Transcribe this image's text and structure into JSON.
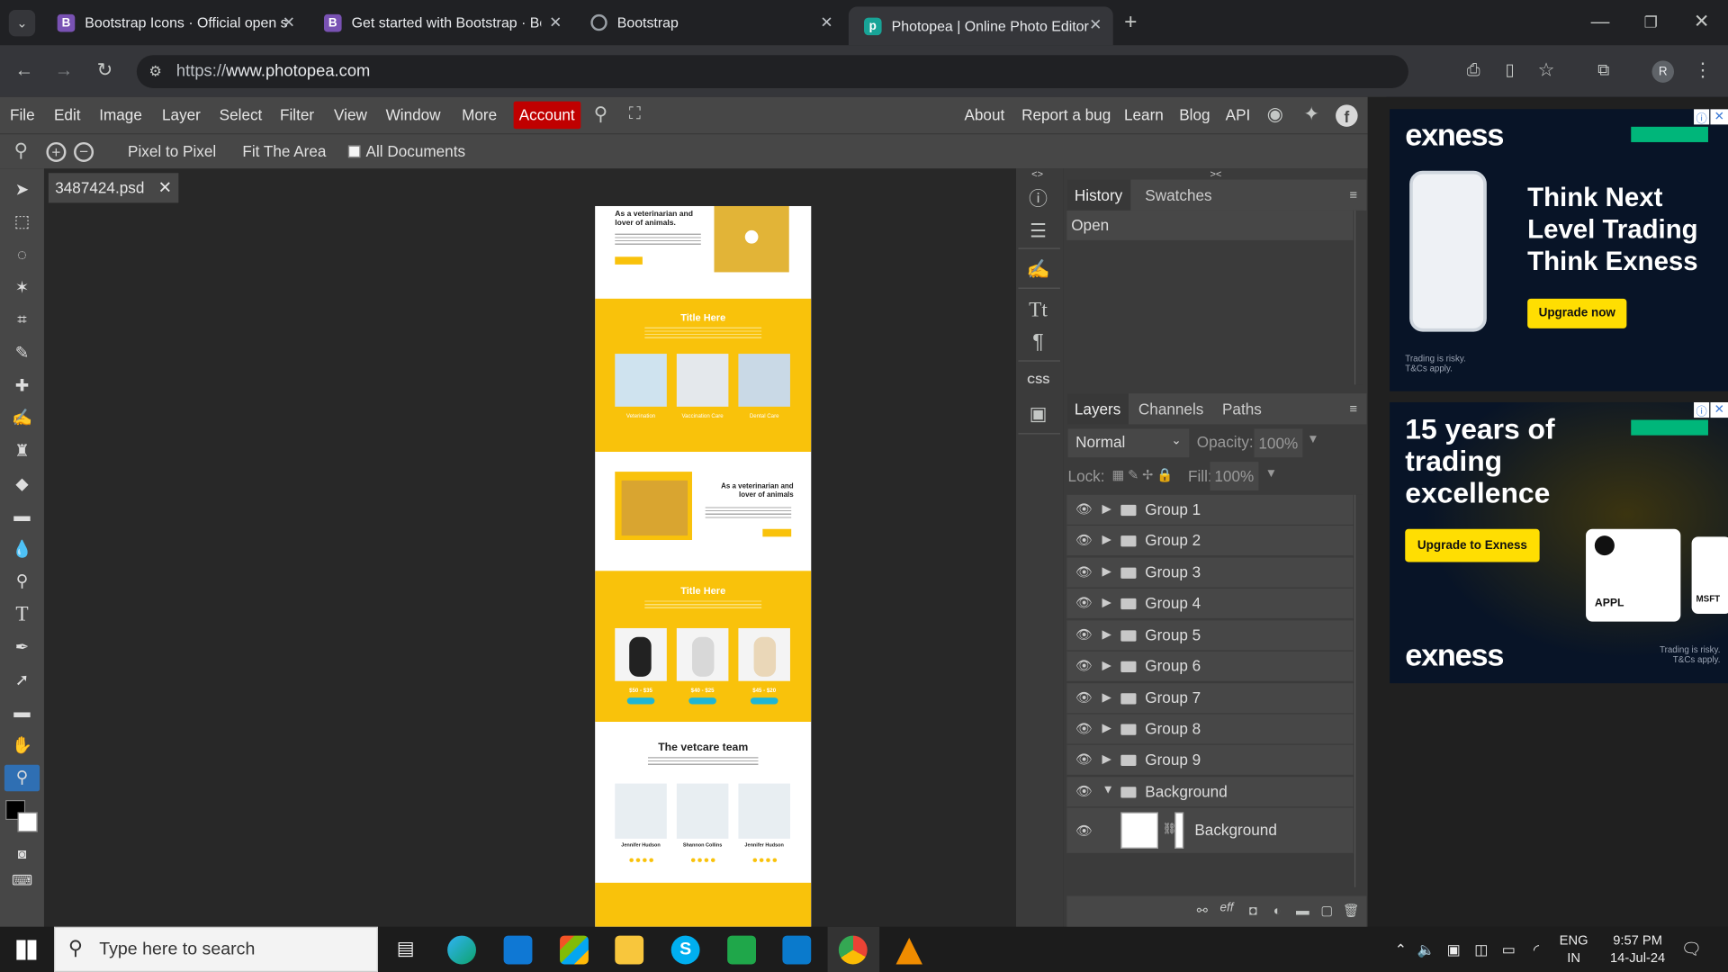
{
  "browser": {
    "tabs": [
      {
        "title": "Bootstrap Icons · Official open s",
        "favicon": "B",
        "color": "#7952b3"
      },
      {
        "title": "Get started with Bootstrap · Boo",
        "favicon": "B",
        "color": "#7952b3"
      },
      {
        "title": "Bootstrap",
        "favicon": "globe-icon",
        "color": "#5f6368"
      },
      {
        "title": "Photopea | Online Photo Editor",
        "favicon": "photopea-icon",
        "color": "#18a497"
      }
    ],
    "url_prefix": "https://",
    "url_host": "www.photopea.com",
    "profile": "R"
  },
  "menubar": {
    "items": [
      "File",
      "Edit",
      "Image",
      "Layer",
      "Select",
      "Filter",
      "View",
      "Window",
      "More"
    ],
    "account": "Account",
    "links": [
      "About",
      "Report a bug",
      "Learn",
      "Blog",
      "API"
    ]
  },
  "toolopts": {
    "pixel_to_pixel": "Pixel to Pixel",
    "fit_area": "Fit The Area",
    "all_docs": "All Documents"
  },
  "document": {
    "tab_name": "3487424.psd",
    "sections": {
      "hero_title": "As a veterinarian and lover of animals.",
      "title1": "Title Here",
      "services": [
        "Veterination",
        "Vaccination Care",
        "Dental Care"
      ],
      "about_title": "As a veterinarian and lover of animals",
      "title2": "Title Here",
      "prices": [
        "$50 - $35",
        "$40 - $25",
        "$45 - $20"
      ],
      "team_title": "The vetcare team",
      "team": [
        "Jennifer Hudson",
        "Shannon Collins",
        "Jennifer Hudson"
      ]
    }
  },
  "history": {
    "tabs": [
      "History",
      "Swatches"
    ],
    "items": [
      "Open"
    ]
  },
  "layers": {
    "tabs": [
      "Layers",
      "Channels",
      "Paths"
    ],
    "blend_mode": "Normal",
    "opacity_label": "Opacity:",
    "opacity": "100%",
    "lock_label": "Lock:",
    "fill_label": "Fill:",
    "fill": "100%",
    "groups": [
      "Group 1",
      "Group 2",
      "Group 3",
      "Group 4",
      "Group 5",
      "Group 6",
      "Group 7",
      "Group 8",
      "Group 9",
      "Background"
    ],
    "child": "Background",
    "footer_fx": "eff"
  },
  "ads": [
    {
      "brand": "exness",
      "headline": "Think Next Level Trading Think Exness",
      "cta": "Upgrade now",
      "disclaimer": "Trading is risky. T&Cs apply."
    },
    {
      "brand": "exness",
      "headline": "15 years of trading excellence",
      "cta": "Upgrade to Exness",
      "stock1": "APPL",
      "stock2": "MSFT",
      "disclaimer": "Trading is risky. T&Cs apply."
    }
  ],
  "taskbar": {
    "search_placeholder": "Type here to search",
    "lang1": "ENG",
    "lang2": "IN",
    "time": "9:57 PM",
    "date": "14-Jul-24"
  },
  "colors": {
    "accent_yellow": "#f9c20b",
    "account_red": "#c00000",
    "panel": "#474747",
    "ad_bg": "#081427"
  }
}
